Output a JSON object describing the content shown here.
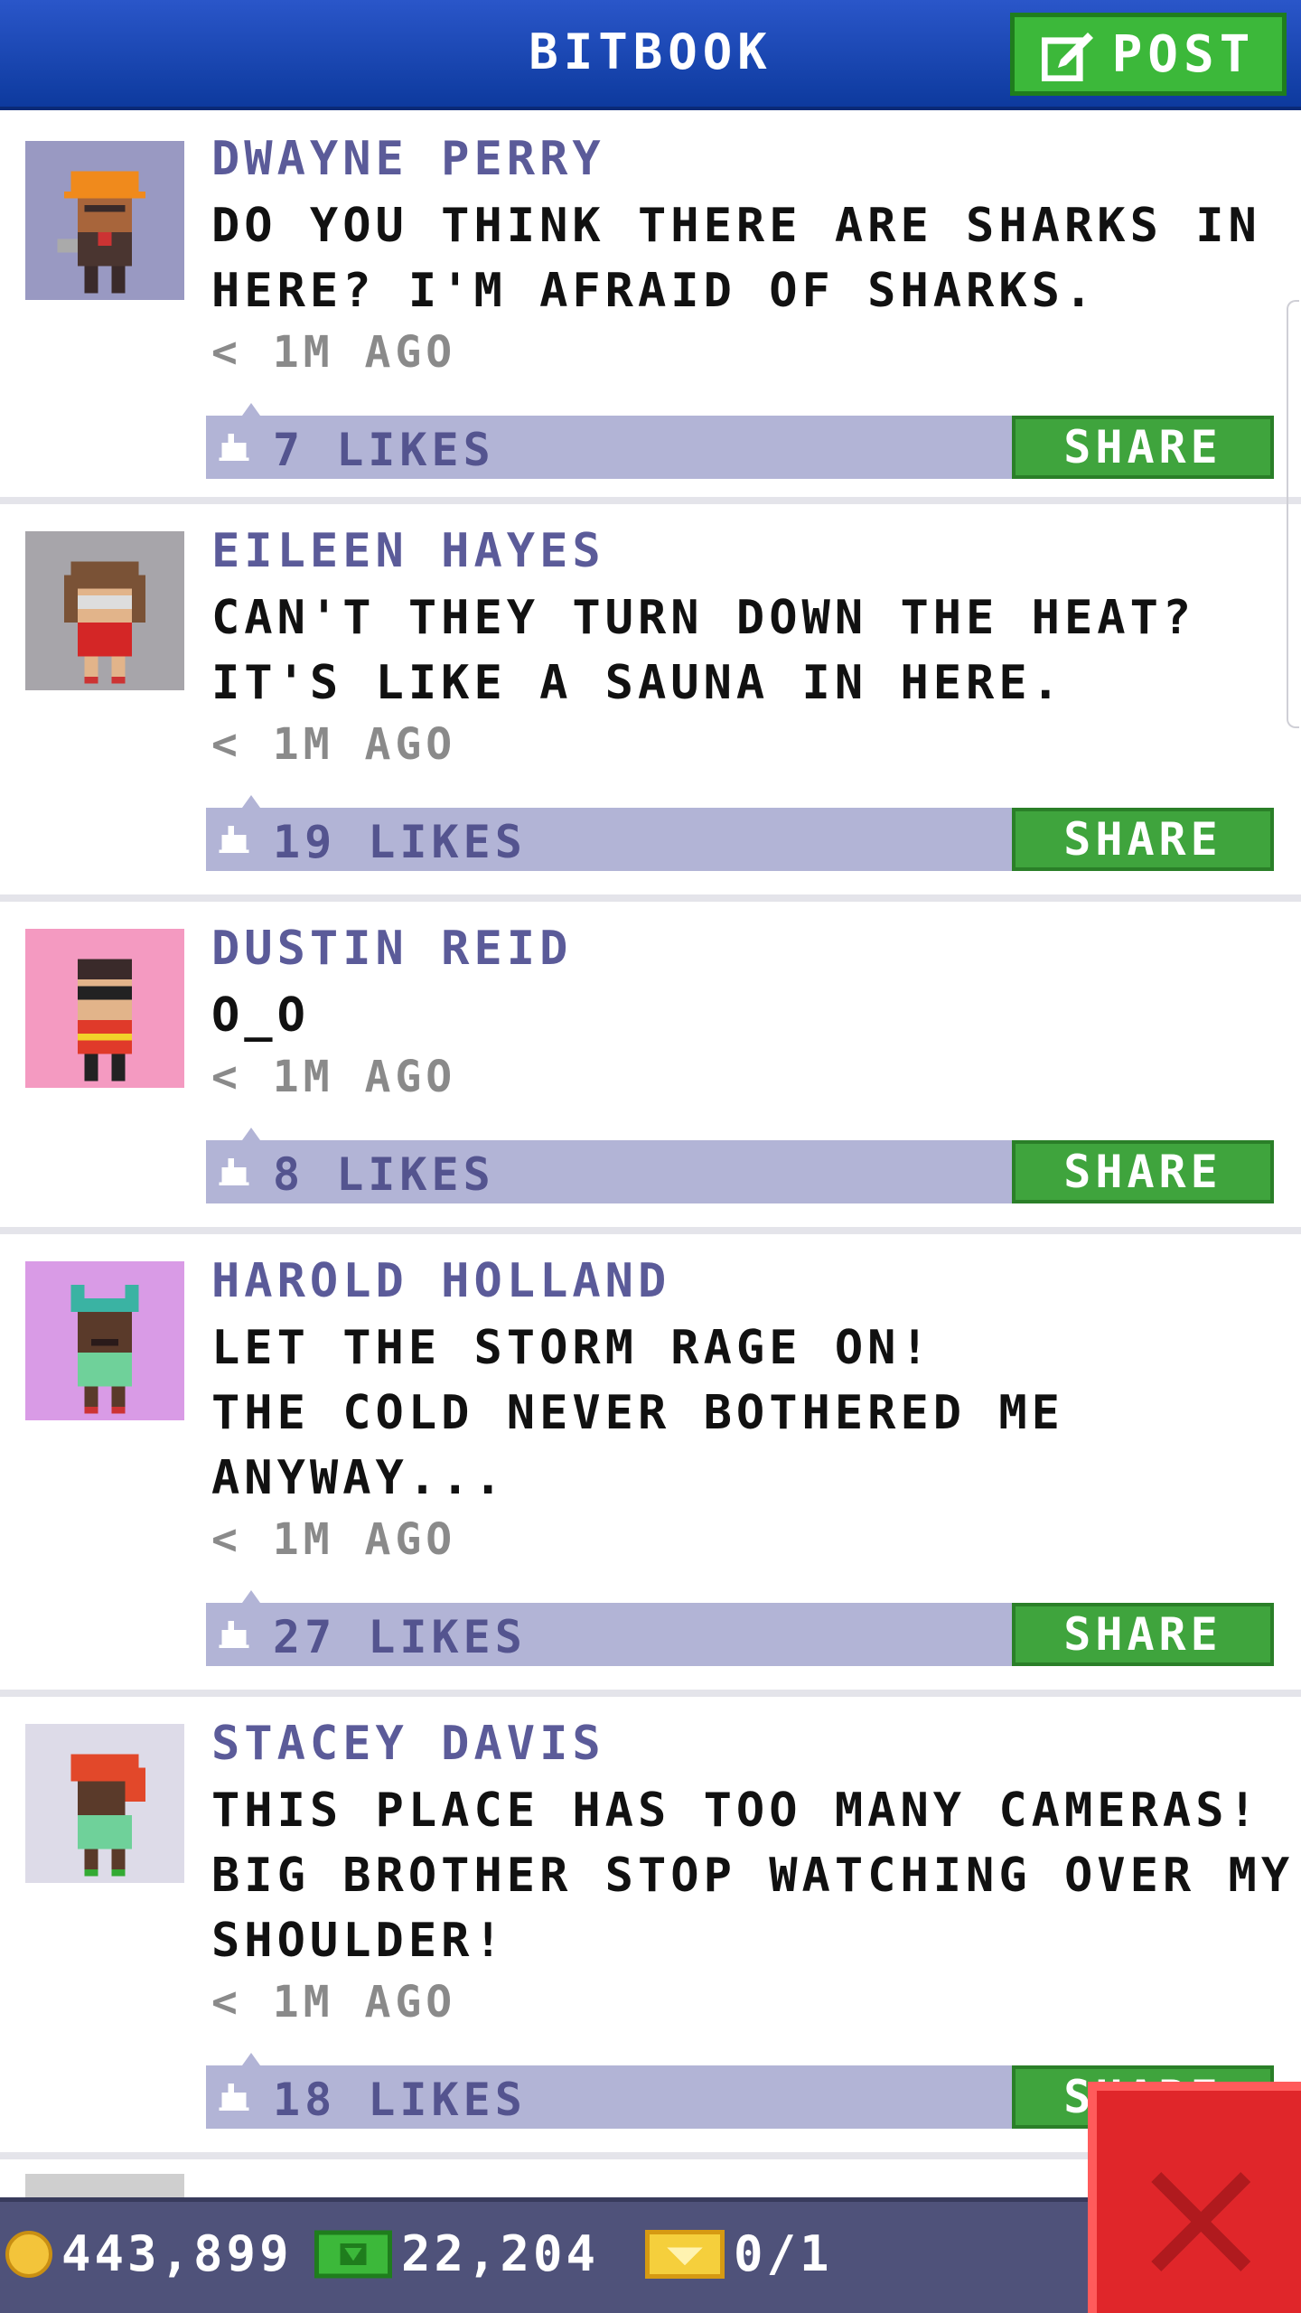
{
  "header": {
    "title": "BITBOOK",
    "post_label": "POST"
  },
  "posts": [
    {
      "author": "DWAYNE PERRY",
      "lines": [
        "DO YOU THINK THERE ARE SHARKS IN",
        "HERE? I'M AFRAID OF SHARKS."
      ],
      "time": "< 1M AGO",
      "likes": "7 LIKES",
      "share_label": "SHARE",
      "avatar_bg": "#9999c2"
    },
    {
      "author": "EILEEN HAYES",
      "lines": [
        "CAN'T THEY TURN DOWN THE HEAT?",
        "IT'S LIKE A SAUNA IN HERE."
      ],
      "time": "< 1M AGO",
      "likes": "19 LIKES",
      "share_label": "SHARE",
      "avatar_bg": "#a7a5aa"
    },
    {
      "author": "DUSTIN REID",
      "lines": [
        "O_O"
      ],
      "time": "< 1M AGO",
      "likes": "8 LIKES",
      "share_label": "SHARE",
      "avatar_bg": "#f49ac1"
    },
    {
      "author": "HAROLD HOLLAND",
      "lines": [
        "LET THE STORM RAGE ON!",
        "THE COLD NEVER BOTHERED ME",
        "ANYWAY..."
      ],
      "time": "< 1M AGO",
      "likes": "27 LIKES",
      "share_label": "SHARE",
      "avatar_bg": "#d99be6"
    },
    {
      "author": "STACEY DAVIS",
      "lines": [
        "THIS PLACE HAS TOO MANY CAMERAS!",
        "BIG BROTHER STOP WATCHING OVER MY",
        "SHOULDER!"
      ],
      "time": "< 1M AGO",
      "likes": "18 LIKES",
      "share_label": "SHARE",
      "avatar_bg": "#dddbe8"
    }
  ],
  "footer": {
    "coins": "443,899",
    "bux": "22,204",
    "tickets": "0/1"
  },
  "colors": {
    "header": "#1846b8",
    "post_button": "#3cb83a",
    "share_button": "#3fa43d",
    "like_bar": "#b2b4d6",
    "close_button": "#e0262a",
    "bottom_bar": "#4f527a"
  },
  "icons": [
    "post-edit-icon",
    "thumbs-up-icon",
    "coin-icon",
    "bux-icon",
    "ticket-icon",
    "close-icon"
  ]
}
